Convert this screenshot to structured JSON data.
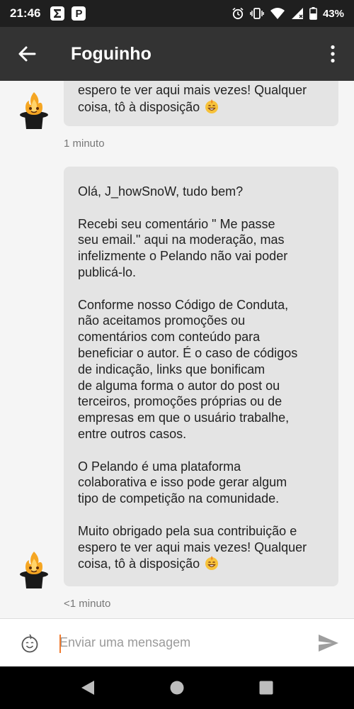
{
  "status_bar": {
    "time": "21:46",
    "battery": "43%",
    "app_icon_letter": "P",
    "icons": [
      "sigma-icon",
      "p-app-icon",
      "alarm-icon",
      "vibrate-icon",
      "wifi-icon",
      "signal-icon",
      "battery-icon"
    ]
  },
  "header": {
    "title": "Foguinho",
    "icons": [
      "back-arrow-icon",
      "more-vert-icon"
    ]
  },
  "messages": [
    {
      "lines": [
        "espero te ver aqui mais vezes! Qualquer",
        "coisa, tô à disposição"
      ],
      "emoji": "smile-emoji",
      "time": "1 minuto"
    },
    {
      "paragraphs": [
        [
          "Olá, J_howSnoW, tudo bem?"
        ],
        [
          "Recebi seu comentário \" Me passe",
          "seu email.\" aqui na moderação, mas",
          "infelizmente o Pelando não vai poder",
          "publicá-lo."
        ],
        [
          "Conforme nosso Código de Conduta,",
          "não aceitamos promoções ou",
          "comentários com conteúdo para",
          "beneficiar o autor. É o caso de códigos",
          "de indicação, links que bonificam",
          "de alguma forma o autor do post ou",
          "terceiros, promoções próprias ou de",
          "empresas em que o usuário trabalhe,",
          "entre outros casos."
        ],
        [
          "O Pelando é uma plataforma",
          "colaborativa e isso pode gerar algum",
          "tipo de competição na comunidade."
        ],
        [
          "Muito obrigado pela sua contribuição e",
          "espero te ver aqui mais vezes! Qualquer",
          "coisa, tô à disposição"
        ]
      ],
      "emoji": "smile-emoji",
      "time": "<1 minuto"
    }
  ],
  "composer": {
    "placeholder": "Enviar uma mensagem",
    "icons": [
      "sticker-icon",
      "send-icon"
    ]
  },
  "nav": {
    "icons": [
      "nav-back-icon",
      "nav-home-icon",
      "nav-recents-icon"
    ]
  },
  "colors": {
    "status_bar": "#1f1f1f",
    "app_bar": "#333333",
    "bubble": "#e4e4e4",
    "background": "#f5f5f5",
    "caret": "#f07a2e"
  }
}
